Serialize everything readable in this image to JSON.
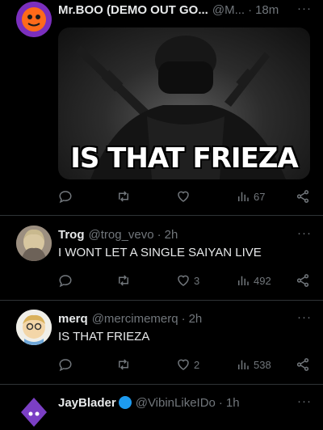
{
  "tweets": [
    {
      "name": "Mr.BOO (DEMO OUT GO...",
      "handle": "@M...",
      "time": "18m",
      "media_caption": "IS THAT FRIEZA",
      "replies": "",
      "retweets": "",
      "likes": "",
      "views": "67",
      "avatar_color": "#7b2fbe"
    },
    {
      "name": "Trog",
      "handle": "@trog_vevo",
      "time": "2h",
      "text": "I WONT LET A SINGLE SAIYAN LIVE",
      "replies": "",
      "retweets": "",
      "likes": "3",
      "views": "492"
    },
    {
      "name": "merq",
      "handle": "@mercimemerq",
      "time": "2h",
      "text": "IS THAT FRIEZA",
      "replies": "",
      "retweets": "",
      "likes": "2",
      "views": "538"
    },
    {
      "name": "JayBlader",
      "handle": "@VibinLikeIDo",
      "time": "1h"
    }
  ],
  "more_glyph": "···",
  "separator": "·",
  "colors": {
    "background": "#000000",
    "text": "#e7e9ea",
    "muted": "#71767b",
    "divider": "#2f3336",
    "verified_badge": "#1d9bf0"
  },
  "icons": [
    "reply-icon",
    "retweet-icon",
    "like-icon",
    "views-icon",
    "share-icon",
    "more-icon"
  ]
}
